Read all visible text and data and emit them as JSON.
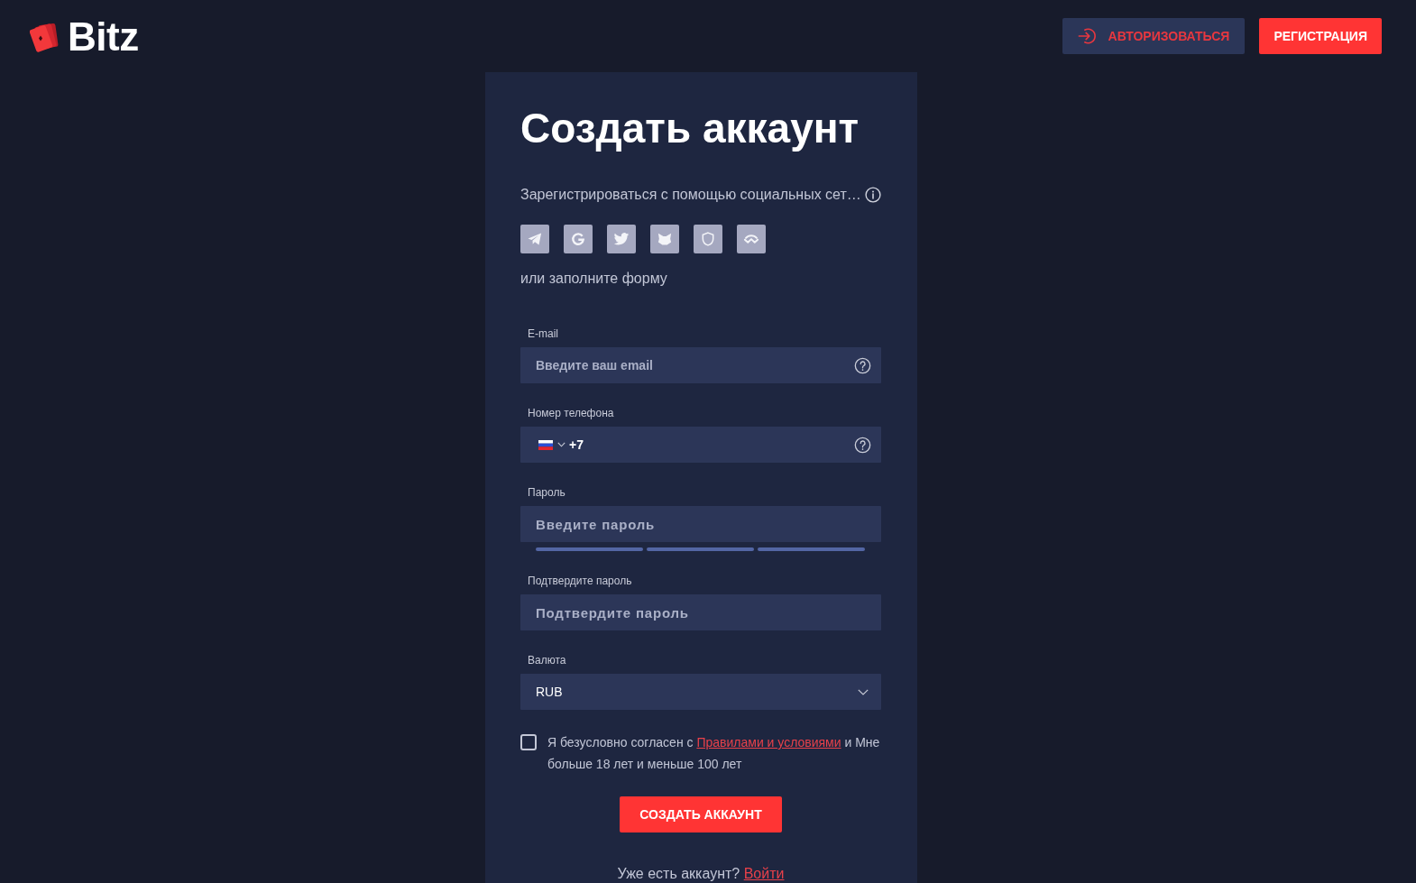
{
  "header": {
    "logo": {
      "text": "Bitz"
    },
    "login_button": {
      "label": "АВТОРИЗОВАТЬСЯ"
    },
    "register_button": {
      "label": "РЕГИСТРАЦИЯ"
    }
  },
  "form": {
    "title": "Создать аккаунт",
    "social_prompt": "Зарегистрироваться с помощью социальных сет…",
    "social_buttons": [
      {
        "kind": "paper-plane"
      },
      {
        "kind": "g"
      },
      {
        "kind": "bird"
      },
      {
        "kind": "fox"
      },
      {
        "kind": "shield"
      },
      {
        "kind": "wave"
      }
    ],
    "alt_prompt": "или заполните форму",
    "fields": [
      {
        "kind": "email",
        "label": "E-mail",
        "placeholder": "Введите ваш email"
      },
      {
        "kind": "phone",
        "label": "Номер телефона",
        "value": "+7"
      },
      {
        "kind": "password",
        "label": "Пароль",
        "placeholder": "Введите пароль",
        "strength_segments": [
          {
            "filled": false
          },
          {
            "filled": false
          },
          {
            "filled": false
          }
        ]
      },
      {
        "kind": "password",
        "label": "Подтвердите пароль",
        "placeholder": "Подтвердите пароль"
      },
      {
        "kind": "select",
        "label": "Валюта",
        "value": "RUB"
      }
    ],
    "agreement": {
      "checked": false,
      "text_before": "Я безусловно согласен с",
      "link": "Правилами и условиями",
      "text_after": "и Мне больше 18 лет и меньше 100 лет"
    },
    "submit_button": {
      "label": "СОЗДАТЬ АККАУНТ"
    },
    "login_prompt": {
      "text": "Уже есть аккаунт?",
      "link": "Войти"
    }
  }
}
